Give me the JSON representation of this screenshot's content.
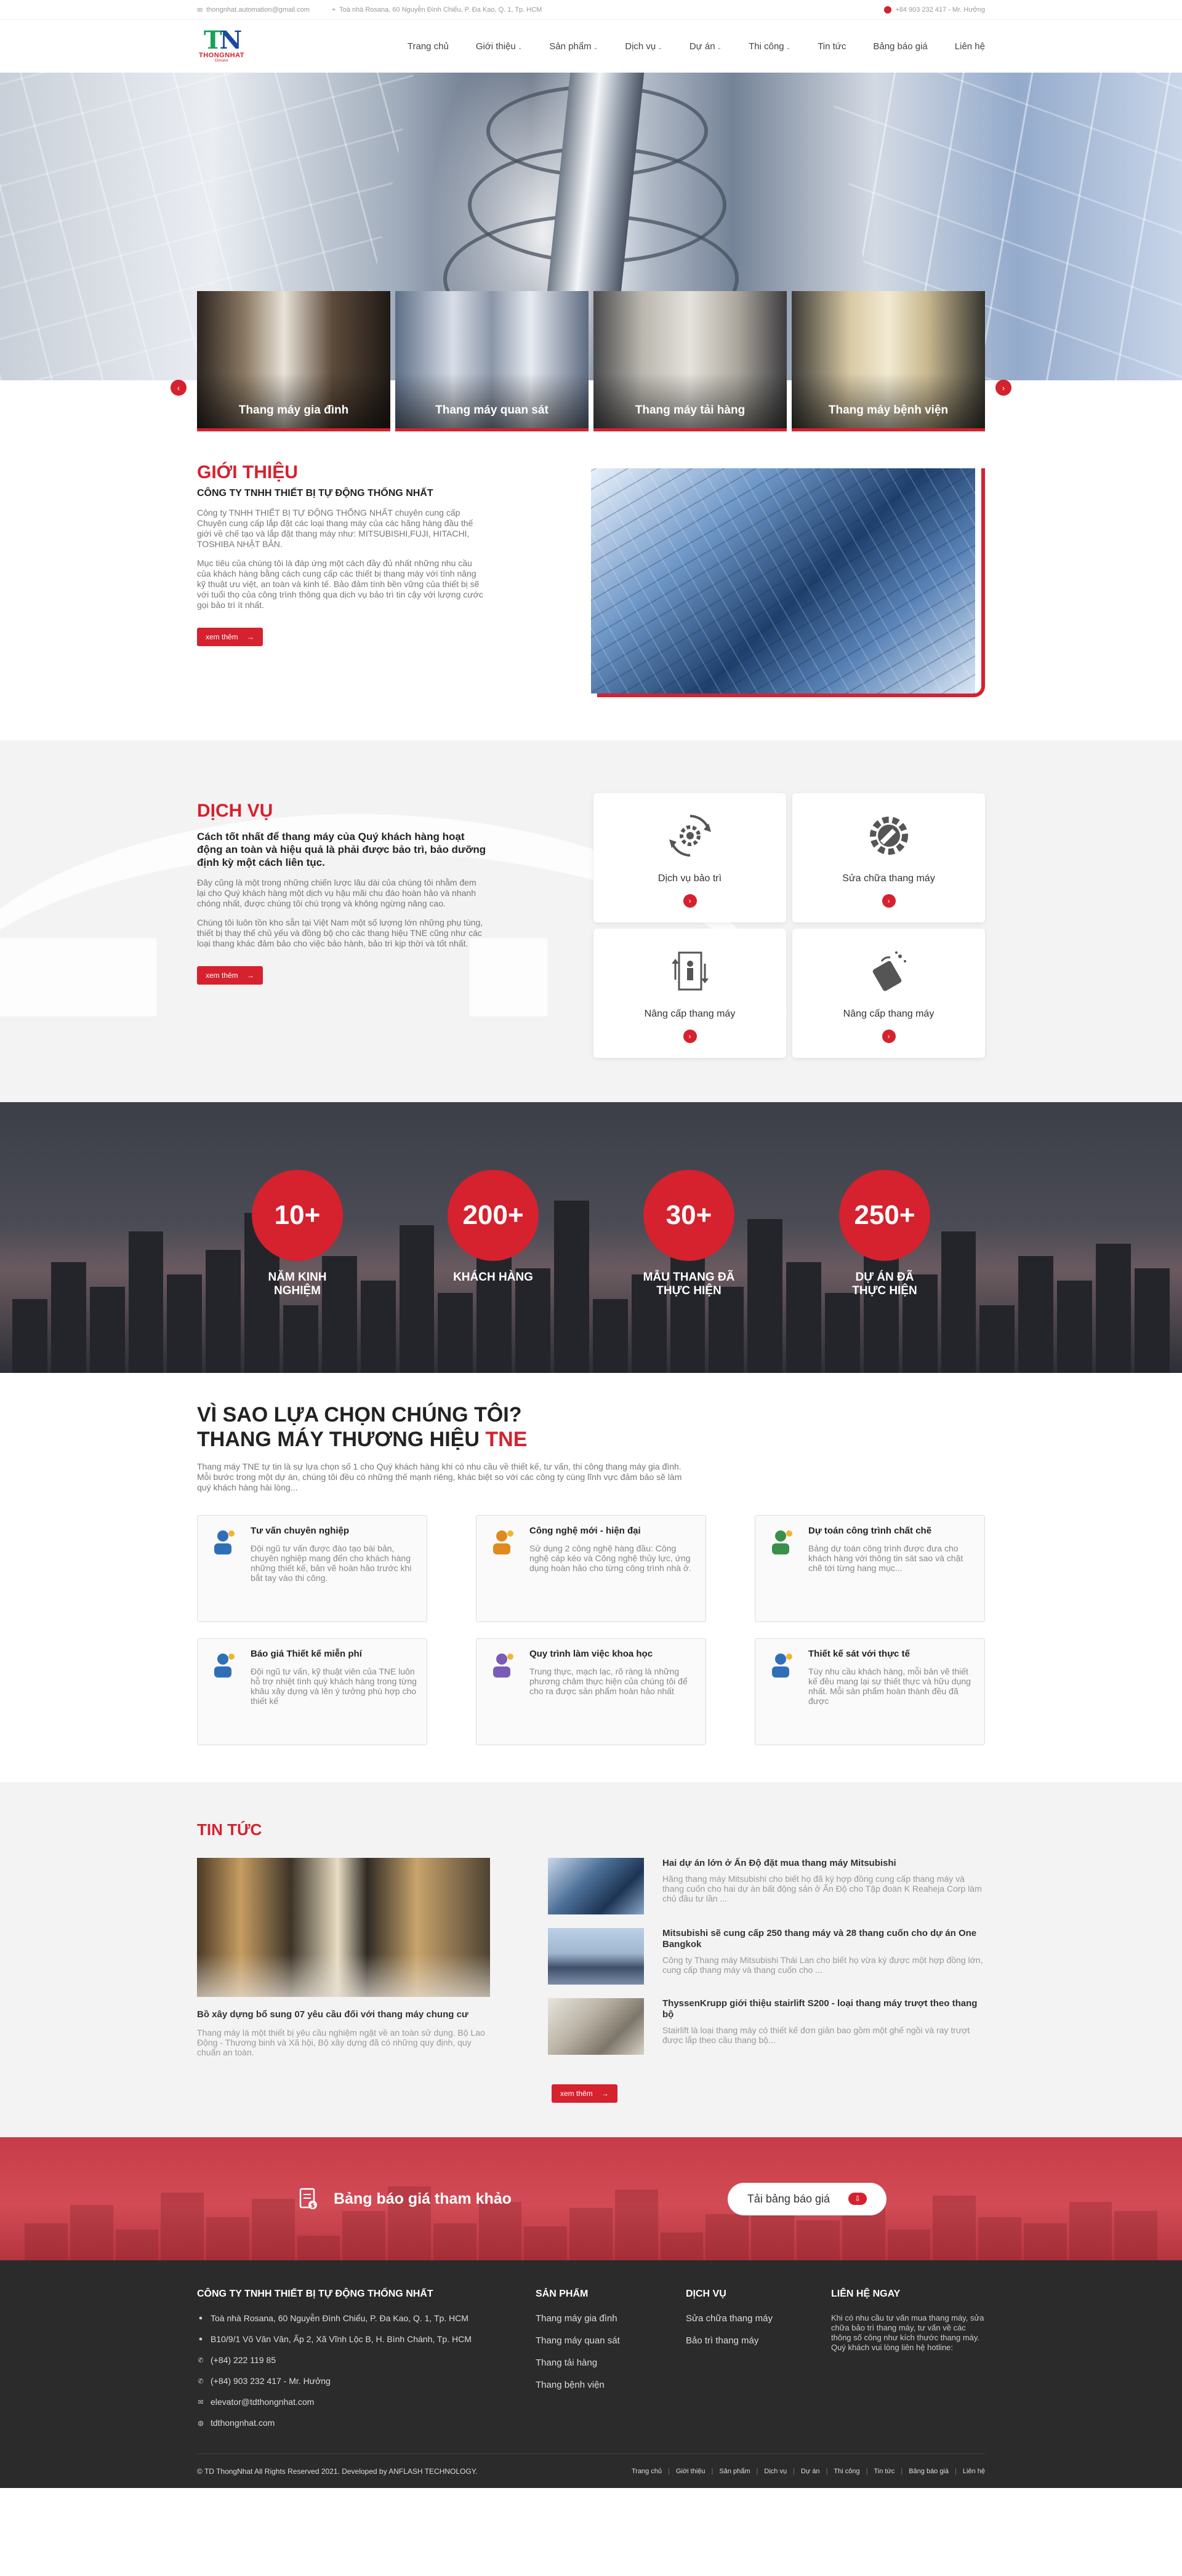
{
  "topbar": {
    "email": "thongnhat.automation@gmail.com",
    "address": "Toà nhà Rosana, 60 Nguyễn Đình Chiểu, P. Đa Kao, Q. 1, Tp. HCM",
    "phone": "+84 903 232 417 - Mr. Hưởng"
  },
  "brand": {
    "name": "THONGNHAT",
    "sub": "Elevator"
  },
  "nav": [
    {
      "label": "Trang chủ",
      "caret": false
    },
    {
      "label": "Giới thiệu",
      "caret": true
    },
    {
      "label": "Sản phẩm",
      "caret": true
    },
    {
      "label": "Dịch vụ",
      "caret": true
    },
    {
      "label": "Dự án",
      "caret": true
    },
    {
      "label": "Thi công",
      "caret": true
    },
    {
      "label": "Tin tức",
      "caret": false
    },
    {
      "label": "Bảng báo giá",
      "caret": false
    },
    {
      "label": "Liên hệ",
      "caret": false
    }
  ],
  "categories": [
    {
      "label": "Thang máy gia đình"
    },
    {
      "label": "Thang máy quan sát"
    },
    {
      "label": "Thang máy tải hàng"
    },
    {
      "label": "Thang máy bệnh viện"
    }
  ],
  "intro": {
    "title": "GIỚI THIỆU",
    "subtitle": "CÔNG TY TNHH THIẾT BỊ TỰ ĐỘNG THỐNG NHẤT",
    "p1": "Công ty TNHH THIẾT BỊ TỰ ĐỘNG THỐNG NHẤT chuyên cung cấp Chuyên cung cấp lắp đặt các loại thang máy của các hãng hàng đầu thế giới về chế tạo và lắp đặt thang máy như: MITSUBISHI,FUJI, HITACHI, TOSHIBA NHẬT BẢN.",
    "p2": "Mục tiêu của chúng tôi là đáp ứng một cách đầy đủ nhất những nhu cầu của khách hàng bằng cách cung cấp các thiết bị thang máy với tính năng kỹ thuật ưu việt, an toàn và kinh tế. Bảo đảm tính bền vững của thiết bị sẽ với tuổi thọ của công trình thông qua dịch vụ bảo trì tin cậy với lượng cước gọi bảo trì ít nhất.",
    "more": "xem thêm"
  },
  "services": {
    "title": "DỊCH VỤ",
    "lead": "Cách tốt nhất để thang máy của Quý khách hàng hoạt động an toàn và hiệu quả là phải được bảo trì, bảo dưỡng định kỳ một cách liên tục.",
    "p1": "Đây cũng là một trong những chiến lược lâu dài của chúng tôi nhằm đem lại cho Quý khách hàng một dịch vụ hậu mãi chu đáo hoàn hảo và nhanh chóng nhất, được chúng tôi chú trọng và không ngừng nâng cao.",
    "p2": "Chúng tôi luôn tồn kho sẵn tại Việt Nam một số lượng lớn những phụ tùng, thiết bị thay thế chủ yếu và đồng bộ cho các thang hiệu TNE cũng như các loại thang khác đảm bảo cho việc bảo hành, bảo trì kịp thời và tốt nhất.",
    "more": "xem thêm",
    "items": [
      {
        "label": "Dịch vụ bảo trì",
        "icon": "maintenance-icon"
      },
      {
        "label": "Sửa chữa thang máy",
        "icon": "gear-wrench-icon"
      },
      {
        "label": "Nâng cấp thang máy",
        "icon": "elevator-upgrade-icon"
      },
      {
        "label": "Nâng cấp thang máy",
        "icon": "cleaning-icon"
      }
    ]
  },
  "stats": [
    {
      "value": "10+",
      "caption": "NĂM KINH NGHIỆM"
    },
    {
      "value": "200+",
      "caption": "KHÁCH HÀNG"
    },
    {
      "value": "30+",
      "caption": "MẪU THANG ĐÃ THỰC HIỆN"
    },
    {
      "value": "250+",
      "caption": "DỰ ÁN ĐÃ THỰC HIỆN"
    }
  ],
  "why": {
    "line1": "VÌ SAO LỰA CHỌN CHÚNG TÔI?",
    "line2": "THANG MÁY THƯƠNG HIỆU",
    "brand": "TNE",
    "desc": "Thang máy TNE tự tin là sự lựa chọn số 1 cho Quý khách hàng khi có nhu cầu về thiết kế, tư vấn, thi công thang máy gia đình. Mỗi bước trong một dự án, chúng tôi đều có những thế mạnh riêng, khác biệt so với các công ty cùng lĩnh vực đảm bảo sẽ làm quý khách hàng hài lòng...",
    "features": [
      {
        "title": "Tư vấn chuyên nghiệp",
        "desc": "Đội ngũ tư vấn được đào tạo bài bản, chuyên nghiệp mang đến cho khách hàng những thiết kế, bản vẽ hoàn hảo trước khi bắt tay vào thi công.",
        "icon": "consultant-icon"
      },
      {
        "title": "Công nghệ mới - hiện đại",
        "desc": "Sử dụng 2 công nghệ hàng đầu: Công nghệ cáp kéo và Công nghệ thủy lực, ứng dụng hoàn hảo cho từng công trình nhà ở.",
        "icon": "technology-icon"
      },
      {
        "title": "Dự toán công trình chất chẽ",
        "desc": "Bảng dự toán công trình được đưa cho khách hàng với thông tin sát sao và chặt chẽ tới từng hang mục...",
        "icon": "estimate-icon"
      },
      {
        "title": "Báo giá Thiết kế miễn phí",
        "desc": "Đội ngũ tư vấn, kỹ thuật viên của TNE luôn hỗ trợ nhiệt tình quý khách hàng trong từng khâu xây dựng và lên ý tưởng phù hợp cho thiết kế",
        "icon": "free-quote-icon"
      },
      {
        "title": "Quy trình làm việc khoa học",
        "desc": "Trung thực, mạch lạc, rõ ràng là những phương châm thực hiện của chúng tôi để cho ra được sản phẩm hoàn hảo nhất",
        "icon": "process-icon"
      },
      {
        "title": "Thiết kế sát với thực tế",
        "desc": "Tùy nhu cầu khách hàng, mỗi bản vẽ thiết kế đều mang lại sự thiết thực và hữu dụng nhất. Mỗi sản phẩm hoàn thành đều đã được",
        "icon": "design-icon"
      }
    ]
  },
  "news": {
    "title": "TIN TỨC",
    "main": {
      "title": "Bồ xây dựng bổ sung 07 yêu cầu đối với thang máy chung cư",
      "desc": "Thang máy là một thiết bị yêu cầu nghiệm ngặt về an toàn sử dụng. Bộ Lao Động - Thương binh và Xã hội, Bộ xây dựng đã có những quy định, quy chuẩn an toàn."
    },
    "items": [
      {
        "title": "Hai dự án lớn ở Ấn Độ đặt mua thang máy Mitsubishi",
        "desc": "Hãng thang máy Mitsubishi cho biết họ đã ký hợp đồng cung cấp thang máy và thang cuốn cho hai dự án bất động sản ở Ấn Độ cho Tập đoàn K Reaheja Corp làm chủ đầu tư lần ..."
      },
      {
        "title": "Mitsubishi sẽ cung cấp 250 thang máy và 28 thang cuốn cho dự án One Bangkok",
        "desc": "Công ty Thang máy Mitsubishi Thái Lan cho biết họ vừa ký được một hợp đồng lớn, cung cấp thang máy và thang cuốn cho ..."
      },
      {
        "title": "ThyssenKrupp giới thiệu stairlift S200 - loại thang máy trượt theo thang bộ",
        "desc": "Stairlift là loại thang máy có thiết kế đơn giản bao gồm một ghế ngồi và ray trượt được lắp theo cầu thang bộ..."
      }
    ],
    "more": "xem thêm"
  },
  "cta": {
    "text": "Bảng báo giá tham khảo",
    "button": "Tải bảng báo giá"
  },
  "footer": {
    "company": {
      "title": "CÔNG TY TNHH THIẾT BỊ TỰ ĐỘNG THỐNG NHẤT",
      "lines": [
        {
          "icon": "location-icon",
          "glyph": "●",
          "text": "Toà nhà Rosana, 60 Nguyễn Đình Chiểu, P. Đa Kao, Q. 1, Tp. HCM"
        },
        {
          "icon": "location-icon",
          "glyph": "●",
          "text": "B10/9/1 Võ Văn Vân, Ấp 2, Xã Vĩnh Lộc B, H. Bình Chánh, Tp. HCM"
        },
        {
          "icon": "phone-icon",
          "glyph": "✆",
          "text": "(+84) 222 119 85"
        },
        {
          "icon": "phone-icon",
          "glyph": "✆",
          "text": "(+84) 903 232 417 - Mr. Hưởng"
        },
        {
          "icon": "email-icon",
          "glyph": "✉",
          "text": "elevator@tdthongnhat.com"
        },
        {
          "icon": "globe-icon",
          "glyph": "◍",
          "text": "tdthongnhat.com"
        }
      ]
    },
    "products": {
      "title": "SẢN PHẨM",
      "items": [
        "Thang máy gia đình",
        "Thang máy quan sát",
        "Thang tải hàng",
        "Thang bệnh viện"
      ]
    },
    "services": {
      "title": "DỊCH VỤ",
      "items": [
        "Sửa chữa thang máy",
        "Bảo trì thang máy"
      ]
    },
    "contact": {
      "title": "LIÊN HỆ NGAY",
      "text": "Khi có nhu cầu tư vấn mua thang máy, sửa chữa bảo trì thang máy, tư vấn về các thông số công như kích thước thang máy. Quý khách vui lòng liên hệ hotline:"
    },
    "copyright": "© TD ThongNhat All Rights Reserved 2021. Developed by ANFLASH TECHNOLOGY.",
    "links": [
      "Trang chủ",
      "Giới thiệu",
      "Sản phẩm",
      "Dịch vụ",
      "Dự án",
      "Thi công",
      "Tin tức",
      "Bảng báo giá",
      "Liên hệ"
    ]
  }
}
